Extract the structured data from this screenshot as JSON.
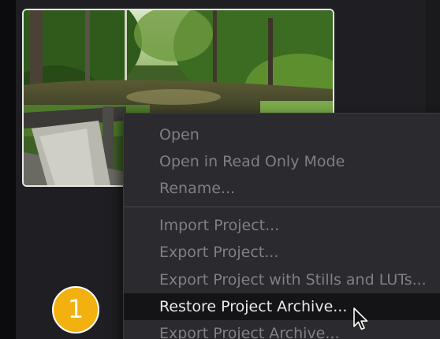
{
  "context_menu": {
    "groups": [
      [
        {
          "label": "Open"
        },
        {
          "label": "Open in Read Only Mode"
        },
        {
          "label": "Rename..."
        }
      ],
      [
        {
          "label": "Import Project..."
        },
        {
          "label": "Export Project..."
        },
        {
          "label": "Export Project with Stills and LUTs..."
        },
        {
          "label": "Restore Project Archive...",
          "highlighted": true
        },
        {
          "label": "Export Project Archive..."
        }
      ]
    ]
  },
  "step_badge": {
    "label": "1",
    "color": "#f2b10f"
  },
  "colors": {
    "menu_background": "#2a2a2f",
    "menu_text_disabled": "#7f7f85",
    "menu_text_highlight": "#e9e9ec",
    "highlight_background": "#141416",
    "thumbnail_border": "#e8e8e8"
  },
  "icons": {
    "cursor": "arrow-cursor-icon"
  }
}
